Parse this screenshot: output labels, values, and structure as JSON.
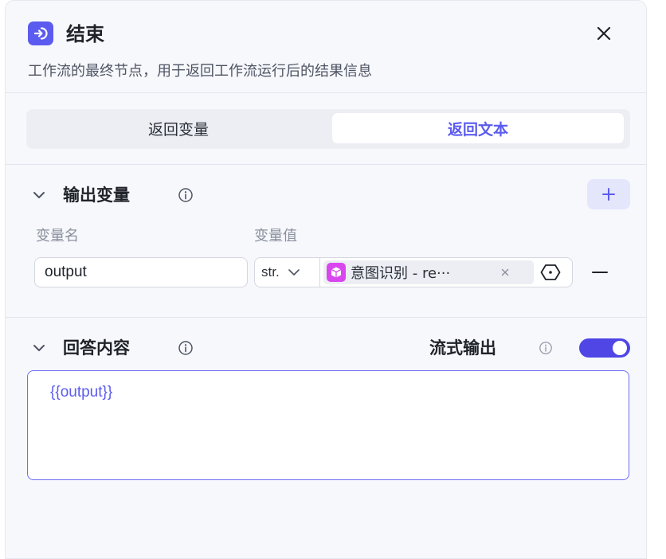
{
  "header": {
    "title": "结束",
    "description": "工作流的最终节点，用于返回工作流运行后的结果信息",
    "logo_icon": "exit-icon",
    "close_icon": "close-icon"
  },
  "tabs": [
    {
      "label": "返回变量",
      "active": false
    },
    {
      "label": "返回文本",
      "active": true
    }
  ],
  "output_section": {
    "title": "输出变量",
    "columns": {
      "name": "变量名",
      "value": "变量值"
    },
    "rows": [
      {
        "name": "output",
        "type": "str.",
        "ref_icon": "intent-cube-icon",
        "ref_label": "意图识别 - re···"
      }
    ]
  },
  "answer_section": {
    "title": "回答内容",
    "stream_label": "流式输出",
    "stream_enabled": true,
    "content": "{{output}}"
  },
  "colors": {
    "accent": "#5b5bf0",
    "toggle": "#4f46e5",
    "chip_icon": "#d946ef",
    "panel_bg": "#f7f8fc"
  }
}
